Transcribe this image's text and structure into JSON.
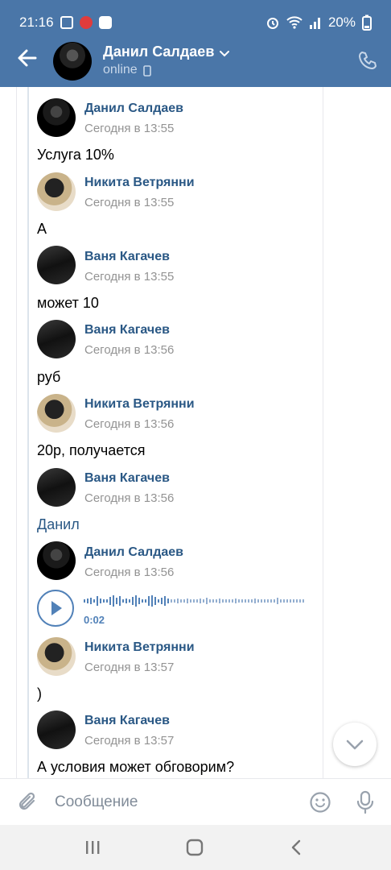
{
  "status_bar": {
    "time": "21:16",
    "battery": "20%"
  },
  "header": {
    "name": "Данил Салдаев",
    "status": "online"
  },
  "messages": [
    {
      "author": "Данил Салдаев",
      "time": "Сегодня в 13:55",
      "text": "Услуга 10%",
      "avatar": "danil"
    },
    {
      "author": "Никита Ветрянни",
      "time": "Сегодня в 13:55",
      "text": "А",
      "avatar": "nikita"
    },
    {
      "author": "Ваня Кагачев",
      "time": "Сегодня в 13:55",
      "text": "может 10",
      "avatar": "vanya"
    },
    {
      "author": "Ваня Кагачев",
      "time": "Сегодня в 13:56",
      "text": "руб",
      "avatar": "vanya"
    },
    {
      "author": "Никита Ветрянни",
      "time": "Сегодня в 13:56",
      "text": "20р, получается",
      "avatar": "nikita"
    },
    {
      "author": "Ваня Кагачев",
      "time": "Сегодня в 13:56",
      "text": "Данил",
      "avatar": "vanya"
    },
    {
      "author": "Данил Салдаев",
      "time": "Сегодня в 13:56",
      "voice_duration": "0:02",
      "avatar": "danil"
    },
    {
      "author": "Никита Ветрянни",
      "time": "Сегодня в 13:57",
      "text": ")",
      "avatar": "nikita"
    },
    {
      "author": "Ваня Кагачев",
      "time": "Сегодня в 13:57",
      "text": "А условия может обговорим?",
      "avatar": "vanya"
    }
  ],
  "composer": {
    "placeholder": "Сообщение"
  },
  "colors": {
    "header_bg": "#4a76a8",
    "accent": "#5181b8",
    "name_link": "#2a5885"
  }
}
